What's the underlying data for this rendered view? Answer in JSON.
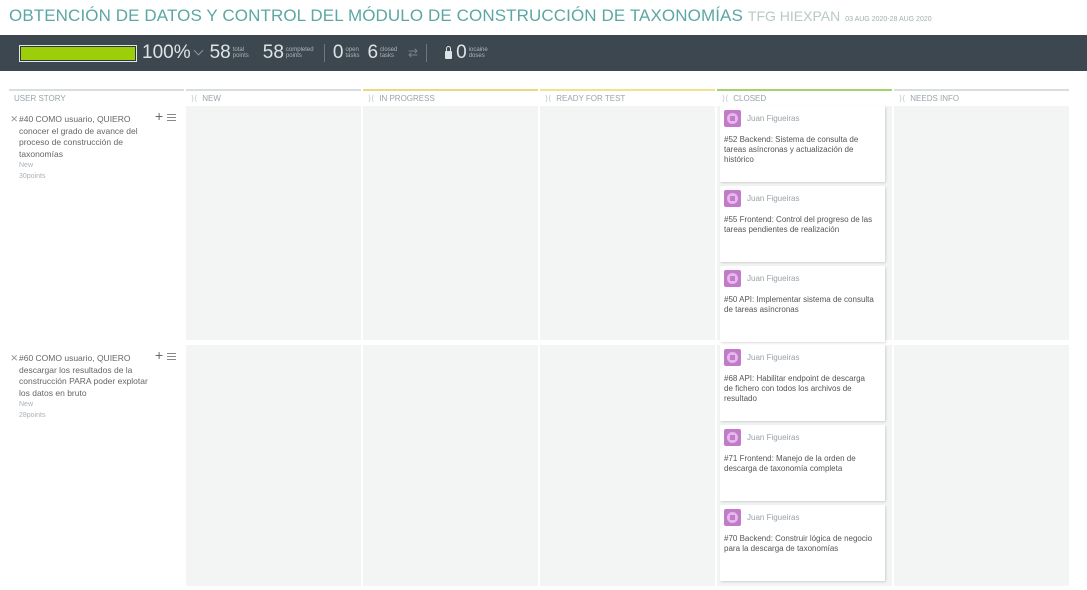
{
  "header": {
    "title": "OBTENCIÓN DE DATOS Y CONTROL DEL MÓDULO DE CONSTRUCCIÓN DE TAXONOMÍAS",
    "project": "TFG HIEXPAN",
    "dates": "03 AUG 2020-28 AUG 2020"
  },
  "stats": {
    "progress_percent": 100,
    "progress_label": "100%",
    "total_points": "58",
    "total_points_label": "total points",
    "completed_points": "58",
    "completed_points_label": "completed points",
    "open_tasks": "0",
    "open_tasks_label": "open tasks",
    "closed_tasks": "6",
    "closed_tasks_label": "closed tasks",
    "iocaine_doses": "0",
    "iocaine_doses_label": "iocaine doses"
  },
  "columns": [
    "USER STORY",
    "NEW",
    "IN PROGRESS",
    "READY FOR TEST",
    "CLOSED",
    "NEEDS INFO"
  ],
  "stories": [
    {
      "title": "#40 COMO usuario, QUIERO conocer el grado de avance del proceso de construcción de taxonomías",
      "status": "New",
      "points": "30points",
      "tasks": [
        {
          "assignee": "Juan Figueiras",
          "title": "#52 Backend: Sistema de consulta de tareas asíncronas y actualización de histórico"
        },
        {
          "assignee": "Juan Figueiras",
          "title": "#55 Frontend: Control del progreso de las tareas pendientes de realización"
        },
        {
          "assignee": "Juan Figueiras",
          "title": "#50 API: Implementar sistema de consulta de tareas asíncronas"
        }
      ]
    },
    {
      "title": "#60 COMO usuario, QUIERO descargar los resultados de la construcción PARA poder explotar los datos en bruto",
      "status": "New",
      "points": "28points",
      "tasks": [
        {
          "assignee": "Juan Figueiras",
          "title": "#68 API: Habilitar endpoint de descarga de fichero con todos los archivos de resultado"
        },
        {
          "assignee": "Juan Figueiras",
          "title": "#71 Frontend: Manejo de la orden de descarga de taxonomía completa"
        },
        {
          "assignee": "Juan Figueiras",
          "title": "#70 Backend: Construir lógica de negocio para la descarga de taxonomías"
        }
      ]
    }
  ]
}
